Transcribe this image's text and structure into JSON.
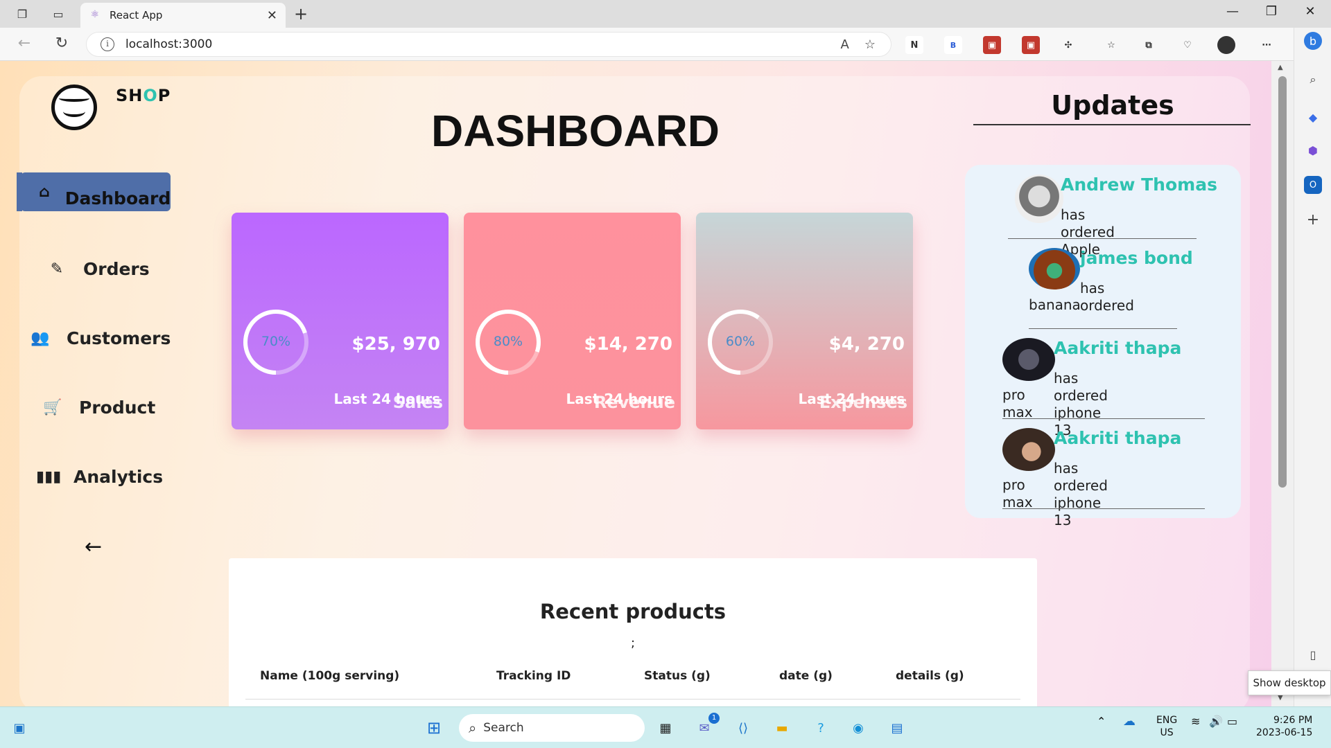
{
  "browser": {
    "tab_title": "React App",
    "url": "localhost:3000",
    "tooltip": "Show desktop"
  },
  "sidebar": {
    "brand_pre": "SH",
    "brand_o": "O",
    "brand_post": "P",
    "items": [
      {
        "label": "Dashboard",
        "icon": "home-icon",
        "active": true
      },
      {
        "label": "Orders",
        "icon": "clipboard-icon"
      },
      {
        "label": "Customers",
        "icon": "users-icon"
      },
      {
        "label": "Product",
        "icon": "cart-icon"
      },
      {
        "label": "Analytics",
        "icon": "bar-chart-icon"
      }
    ]
  },
  "main": {
    "title": "DASHBOARD",
    "cards": [
      {
        "title": "Sales",
        "percent": "70%",
        "value": "$25, 970",
        "period": "Last 24 hours",
        "progress": 70,
        "color_top": "#bb67ff",
        "color_bottom": "#c484f3"
      },
      {
        "title": "Revenue",
        "percent": "80%",
        "value": "$14, 270",
        "period": "Last 24 hours",
        "progress": 80,
        "color_top": "#ff919d",
        "color_bottom": "#fc929d"
      },
      {
        "title": "Expenses",
        "percent": "60%",
        "value": "$4, 270",
        "period": "Last 24 hours",
        "progress": 60,
        "color_top": "#c6d6d8",
        "color_bottom": "#f7979e"
      }
    ],
    "recent": {
      "title": "Recent products",
      "semicolon": ";",
      "headers": [
        "Name (100g serving)",
        "Tracking ID",
        "Status (g)",
        "date (g)",
        "details (g)"
      ]
    }
  },
  "updates": {
    "title": "Updates",
    "items": [
      {
        "name": "Andrew Thomas",
        "text": "has ordered Apple"
      },
      {
        "name": "james bond",
        "text_line1": "has ordered",
        "text_line2": "banana"
      },
      {
        "name": "Aakriti thapa",
        "text_line1": "has ordered iphone 13",
        "text_line2": "pro max"
      },
      {
        "name": "Aakriti thapa",
        "text_line1": "has ordered iphone 13",
        "text_line2": "pro max"
      }
    ]
  },
  "taskbar": {
    "search_label": "Search",
    "lang_line1": "ENG",
    "lang_line2": "US",
    "time": "9:26 PM",
    "date": "2023-06-15",
    "chat_badge": "1"
  }
}
